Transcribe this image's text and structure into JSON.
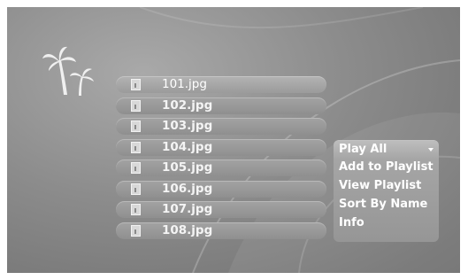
{
  "files": [
    {
      "name": "101.jpg"
    },
    {
      "name": "102.jpg"
    },
    {
      "name": "103.jpg"
    },
    {
      "name": "104.jpg"
    },
    {
      "name": "105.jpg"
    },
    {
      "name": "106.jpg"
    },
    {
      "name": "107.jpg"
    },
    {
      "name": "108.jpg"
    }
  ],
  "menu": {
    "items": [
      {
        "label": "Play All"
      },
      {
        "label": "Add to Playlist"
      },
      {
        "label": "View Playlist"
      },
      {
        "label": "Sort By Name"
      },
      {
        "label": "Info"
      }
    ],
    "highlighted": "Play All"
  },
  "icons": {
    "logo": "palm-trees-icon",
    "file": "image-file-icon",
    "menu_arrow": "chevron-down-icon"
  }
}
